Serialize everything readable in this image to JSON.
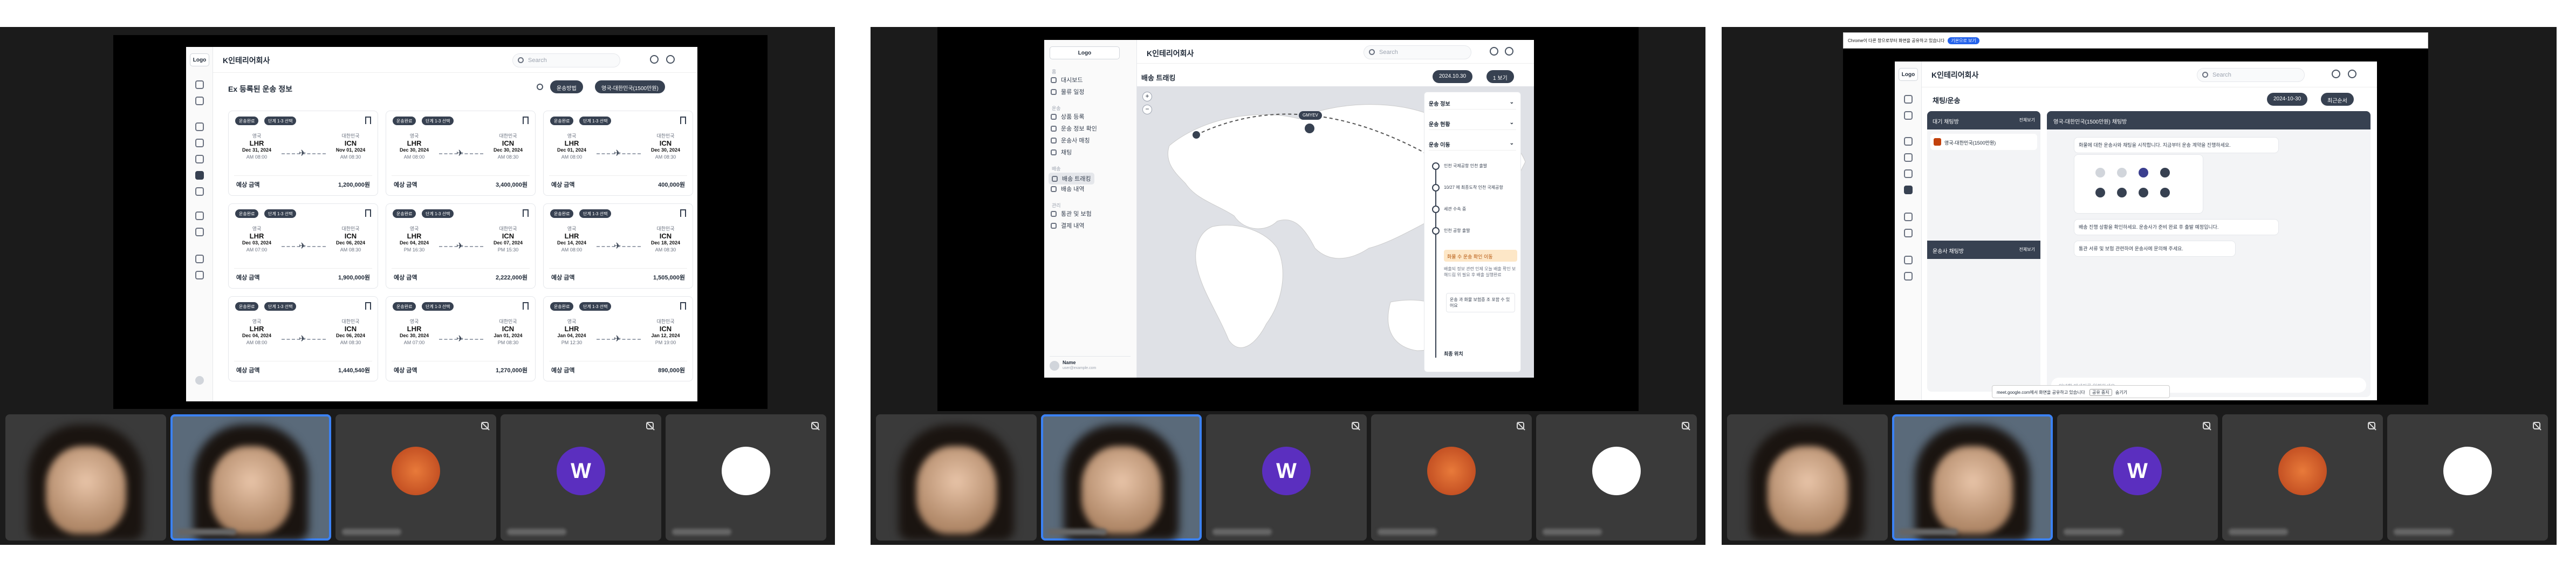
{
  "panel1": {
    "logo": "Logo",
    "company": "K인테리어회사",
    "search_placeholder": "Search",
    "page_title": "Ex 등록된 운송 정보",
    "filter_status": "운송방법",
    "filter_route": "영국-대한민국(1500만원)",
    "cards": [
      {
        "tags": [
          "운송완료",
          "단계 1-3 선택"
        ],
        "from_country": "영국",
        "from": "LHR",
        "from_date": "Dec 31, 2024",
        "from_time": "AM 08:00",
        "to_country": "대한민국",
        "to": "ICN",
        "to_date": "Nov 01, 2024",
        "to_time": "AM 08:30",
        "price_label": "예상 금액",
        "price": "1,200,000원"
      },
      {
        "tags": [
          "운송완료",
          "단계 1-3 선택"
        ],
        "from_country": "영국",
        "from": "LHR",
        "from_date": "Dec 30, 2024",
        "from_time": "AM 08:00",
        "to_country": "대한민국",
        "to": "ICN",
        "to_date": "Dec 30, 2024",
        "to_time": "AM 08:30",
        "price_label": "예상 금액",
        "price": "3,400,000원"
      },
      {
        "tags": [
          "운송완료",
          "단계 1-3 선택"
        ],
        "from_country": "영국",
        "from": "LHR",
        "from_date": "Dec 01, 2024",
        "from_time": "AM 08:00",
        "to_country": "대한민국",
        "to": "ICN",
        "to_date": "Dec 30, 2024",
        "to_time": "AM 08:30",
        "price_label": "예상 금액",
        "price": "400,000원"
      },
      {
        "tags": [
          "운송완료",
          "단계 1-3 선택"
        ],
        "from_country": "영국",
        "from": "LHR",
        "from_date": "Dec 03, 2024",
        "from_time": "AM 07:00",
        "to_country": "대한민국",
        "to": "ICN",
        "to_date": "Dec 06, 2024",
        "to_time": "AM 08:30",
        "price_label": "예상 금액",
        "price": "1,900,000원"
      },
      {
        "tags": [
          "운송완료",
          "단계 1-3 선택"
        ],
        "from_country": "영국",
        "from": "LHR",
        "from_date": "Dec 04, 2024",
        "from_time": "PM 16:30",
        "to_country": "대한민국",
        "to": "ICN",
        "to_date": "Dec 07, 2024",
        "to_time": "PM 15:30",
        "price_label": "예상 금액",
        "price": "2,222,000원"
      },
      {
        "tags": [
          "운송완료",
          "단계 1-3 선택"
        ],
        "from_country": "영국",
        "from": "LHR",
        "from_date": "Dec 14, 2024",
        "from_time": "AM 08:00",
        "to_country": "대한민국",
        "to": "ICN",
        "to_date": "Dec 18, 2024",
        "to_time": "AM 08:30",
        "price_label": "예상 금액",
        "price": "1,505,000원"
      },
      {
        "tags": [
          "운송완료",
          "단계 1-3 선택"
        ],
        "from_country": "영국",
        "from": "LHR",
        "from_date": "Dec 04, 2024",
        "from_time": "AM 08:00",
        "to_country": "대한민국",
        "to": "ICN",
        "to_date": "Dec 06, 2024",
        "to_time": "AM 08:30",
        "price_label": "예상 금액",
        "price": "1,440,540원"
      },
      {
        "tags": [
          "운송완료",
          "단계 1-3 선택"
        ],
        "from_country": "영국",
        "from": "LHR",
        "from_date": "Dec 30, 2024",
        "from_time": "AM 07:00",
        "to_country": "대한민국",
        "to": "ICN",
        "to_date": "Jan 01, 2024",
        "to_time": "PM 08:30",
        "price_label": "예상 금액",
        "price": "1,270,000원"
      },
      {
        "tags": [
          "운송완료",
          "단계 1-3 선택"
        ],
        "from_country": "영국",
        "from": "LHR",
        "from_date": "Jan 04, 2024",
        "from_time": "PM 12:30",
        "to_country": "대한민국",
        "to": "ICN",
        "to_date": "Jan 12, 2024",
        "to_time": "PM 19:00",
        "price_label": "예상 금액",
        "price": "890,000원"
      }
    ]
  },
  "panel2": {
    "logo": "Logo",
    "company": "K인테리어회사",
    "search_placeholder": "Search",
    "page_title": "배송 트래킹",
    "date_chip": "2024.10.30",
    "view_chip": "1 보기",
    "marker_label": "GMYEV",
    "sidebar": [
      {
        "section": "홈",
        "items": [
          "대시보드",
          "물류 일정"
        ]
      },
      {
        "section": "운송",
        "items": [
          "상품 등록",
          "운송 정보 확인",
          "운송사 매칭",
          "채팅"
        ]
      },
      {
        "section": "배송",
        "items": [
          "배송 트래킹",
          "배송 내역"
        ]
      },
      {
        "section": "관리",
        "items": [
          "통관 및 보험",
          "결제 내역"
        ]
      }
    ],
    "user_name": "Name",
    "user_email": "user@example.com",
    "track_sections": [
      "운송 정보",
      "운송 현황",
      "운송 이동"
    ],
    "timeline": [
      "인천 국제공항 인천 출발",
      "10/27 에 최종도착 인천 국제공항",
      "세관 수속 중",
      "인천 공항 출발"
    ],
    "highlight": "화물 수 운송 확인 이동",
    "detail": "배출되 정보 관련 인제 오늘 배출 확인 보해드림 위 필요 후 배출 실행완료",
    "detail2": "운송 과 화물 보험증 조 포함 수 있어요",
    "end_label": "최종 위치"
  },
  "panel3": {
    "logo": "Logo",
    "company": "K인테리어회사",
    "search_placeholder": "Search",
    "page_title": "채팅/운송",
    "banner": "Chrome이 다른 창으로부터 화면을 공유하고 있습니다",
    "banner_btn": "기본으로 보기",
    "date_chip": "2024-10-30",
    "sort_chip": "최근순서",
    "list_header": "대기 채팅방",
    "list_header2": "운송사 채팅방",
    "list_count": "전체보기",
    "chat_item": "영국-대한민국(1500만원)",
    "chat_title": "영국-대한민국(1500만원) 채팅방",
    "msg1": "화물에 대한 운송사와 채팅을 시작합니다. 지금부터 운송 계약을 진행하세요.",
    "msg2": "배송 진행 상황을 확인하세요. 운송사가 준비 완료 후 출발 예정입니다.",
    "msg3": "통관 서류 및 보험 관련하여 운송사에 문의해 주세요.",
    "input_placeholder": "안녕할 메세지를 입력하세요",
    "prompt": "meet.google.com에서 화면을 공유하고 있습니다",
    "prompt_btn1": "공유 중지",
    "prompt_btn2": "숨기기"
  },
  "avatars": [
    {
      "letter": "W",
      "color": "#5b2fbf"
    },
    {
      "letter": "",
      "color": "#ffffff"
    }
  ]
}
